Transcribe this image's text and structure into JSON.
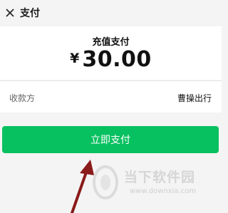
{
  "header": {
    "title": "支付",
    "close_icon": "close-icon"
  },
  "payment": {
    "label": "充值支付",
    "currency": "¥",
    "amount": "30.00"
  },
  "payee": {
    "label": "收款方",
    "value": "曹操出行"
  },
  "actions": {
    "pay_label": "立即支付",
    "pay_color": "#07c160"
  },
  "watermark": {
    "title": "当下软件园",
    "url": "www.downxia.com"
  },
  "colors": {
    "background": "#f4f4f4",
    "arrow": "#8b1a1a"
  }
}
